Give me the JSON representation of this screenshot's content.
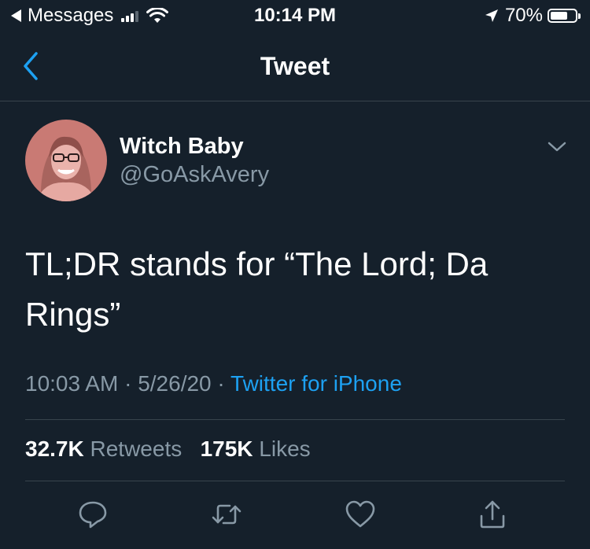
{
  "status_bar": {
    "back_app": "Messages",
    "time": "10:14 PM",
    "battery_percent": "70%",
    "battery_level": 0.7
  },
  "nav": {
    "title": "Tweet"
  },
  "tweet": {
    "display_name": "Witch Baby",
    "handle": "@GoAskAvery",
    "text": "TL;DR stands for “The Lord; Da Rings”",
    "time": "10:03 AM",
    "date": "5/26/20",
    "separator": "·",
    "source": "Twitter for iPhone",
    "retweets_count": "32.7K",
    "retweets_label": "Retweets",
    "likes_count": "175K",
    "likes_label": "Likes"
  },
  "actions": [
    "reply-icon",
    "retweet-icon",
    "like-icon",
    "share-icon"
  ],
  "colors": {
    "background": "#15202b",
    "accent": "#1da1f2",
    "secondary_text": "#8899a6",
    "divider": "#38444d"
  }
}
